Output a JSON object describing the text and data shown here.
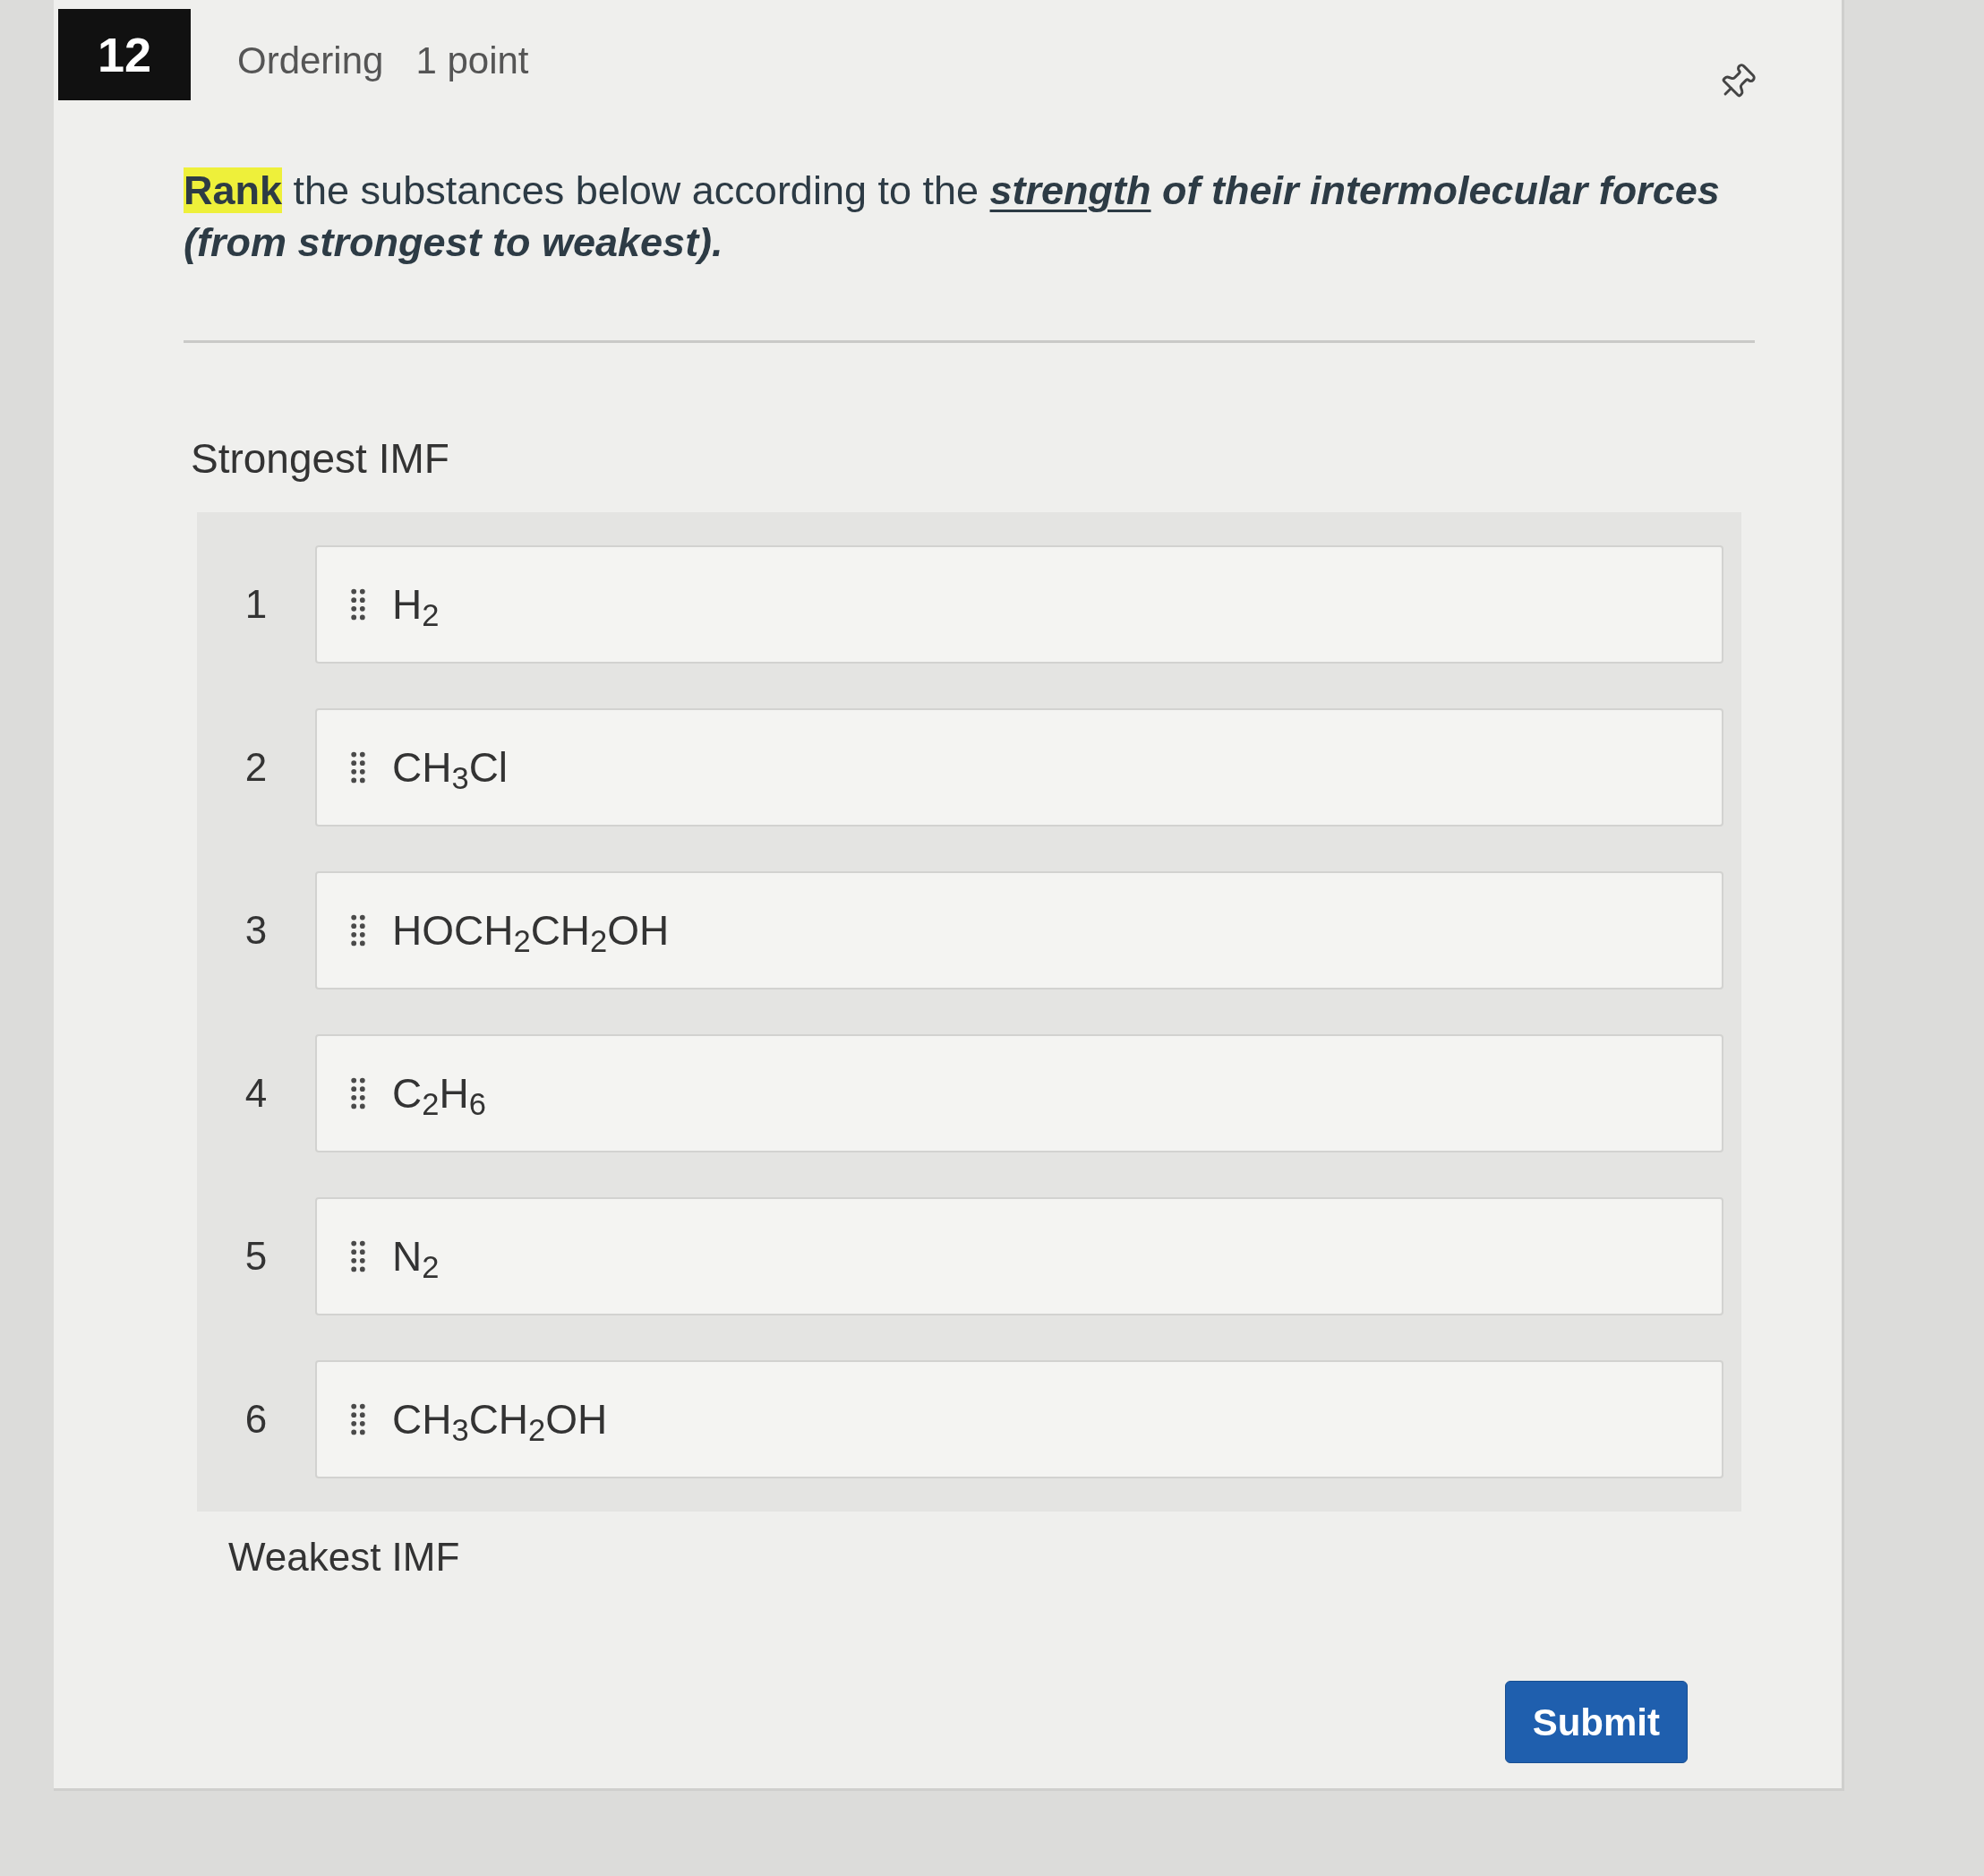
{
  "question_header": {
    "number": "12",
    "type": "Ordering",
    "points": "1 point"
  },
  "question_text": [
    {
      "text": "Rank",
      "kind": "highlighted"
    },
    {
      "text": " the substances below according to the ",
      "kind": "plain"
    },
    {
      "text": "strength",
      "kind": "underlined"
    },
    {
      "text": " of their intermolecular forces (from strongest to weakest).",
      "kind": "emphasis"
    }
  ],
  "top_label": "Strongest IMF",
  "ordering_items": [
    {
      "rank": "1",
      "label": "H$_{2}$"
    },
    {
      "rank": "2",
      "label": "CH$_{3}$Cl"
    },
    {
      "rank": "3",
      "label": "HOCH$_{2}$CH$_{2}$OH"
    },
    {
      "rank": "4",
      "label": "C$_{2}$H$_{6}$"
    },
    {
      "rank": "5",
      "label": "N$_{2}$"
    },
    {
      "rank": "6",
      "label": "CH$_{3}$CH$_{2}$OH"
    }
  ],
  "bottom_label": "Weakest IMF",
  "buttons": [
    {
      "label": "Submit",
      "kind": "primary"
    }
  ]
}
